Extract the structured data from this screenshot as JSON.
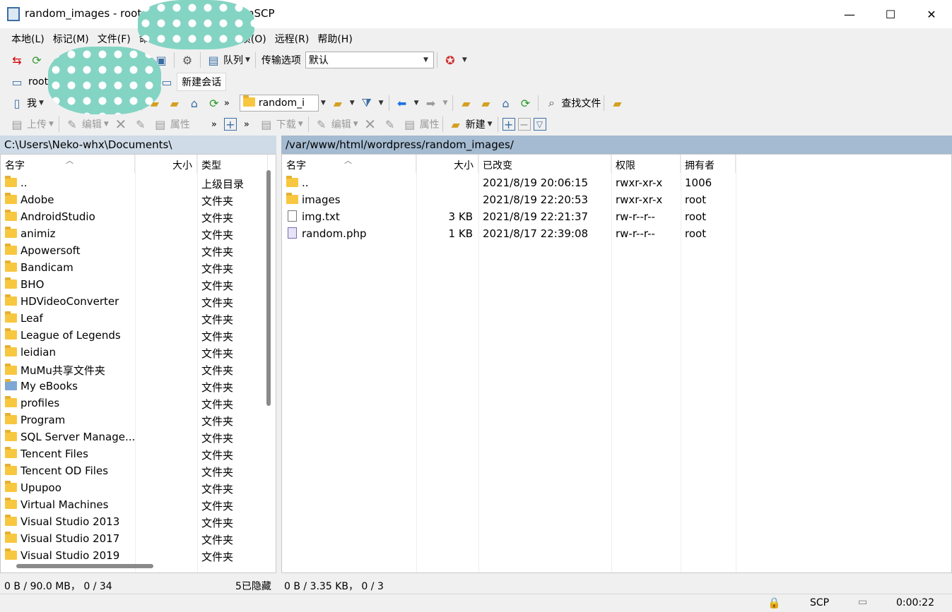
{
  "window": {
    "title": "random_images - root@",
    "title_tail": "nSCP",
    "minimize": "—",
    "maximize": "☐",
    "close": "✕"
  },
  "menu": [
    "本地(L)",
    "标记(M)",
    "文件(F)",
    "命",
    "",
    "",
    "项(O)",
    "远程(R)",
    "帮助(H)"
  ],
  "toolbar1": {
    "queue_label": "队列",
    "transfer_options_label": "传输选项",
    "transfer_options_value": "默认"
  },
  "session": {
    "tab_label": "root@",
    "new_session": "新建会话"
  },
  "local_nav": {
    "drive": "我"
  },
  "remote_nav": {
    "dir": "random_i",
    "find_files": "查找文件"
  },
  "local_actions": {
    "upload": "上传",
    "edit": "编辑",
    "properties": "属性"
  },
  "remote_actions": {
    "download": "下载",
    "edit": "编辑",
    "properties": "属性",
    "new": "新建"
  },
  "local_path": "C:\\Users\\Neko-whx\\Documents\\",
  "remote_path": "/var/www/html/wordpress/random_images/",
  "local_columns": {
    "name": "名字",
    "size": "大小",
    "type": "类型"
  },
  "remote_columns": {
    "name": "名字",
    "size": "大小",
    "modified": "已改变",
    "perms": "权限",
    "owner": "拥有者"
  },
  "local_files": [
    {
      "name": "..",
      "type": "上级目录",
      "icon": "parent"
    },
    {
      "name": "Adobe",
      "type": "文件夹",
      "icon": "folder"
    },
    {
      "name": "AndroidStudio",
      "type": "文件夹",
      "icon": "folder"
    },
    {
      "name": "animiz",
      "type": "文件夹",
      "icon": "folder"
    },
    {
      "name": "Apowersoft",
      "type": "文件夹",
      "icon": "folder"
    },
    {
      "name": "Bandicam",
      "type": "文件夹",
      "icon": "folder"
    },
    {
      "name": "BHO",
      "type": "文件夹",
      "icon": "folder"
    },
    {
      "name": "HDVideoConverter",
      "type": "文件夹",
      "icon": "folder"
    },
    {
      "name": "Leaf",
      "type": "文件夹",
      "icon": "folder"
    },
    {
      "name": "League of Legends",
      "type": "文件夹",
      "icon": "folder"
    },
    {
      "name": "leidian",
      "type": "文件夹",
      "icon": "folder"
    },
    {
      "name": "MuMu共享文件夹",
      "type": "文件夹",
      "icon": "folder"
    },
    {
      "name": "My eBooks",
      "type": "文件夹",
      "icon": "ebooks"
    },
    {
      "name": "profiles",
      "type": "文件夹",
      "icon": "folder"
    },
    {
      "name": "Program",
      "type": "文件夹",
      "icon": "folder"
    },
    {
      "name": "SQL Server Manage...",
      "type": "文件夹",
      "icon": "folder"
    },
    {
      "name": "Tencent Files",
      "type": "文件夹",
      "icon": "folder"
    },
    {
      "name": "Tencent OD Files",
      "type": "文件夹",
      "icon": "folder"
    },
    {
      "name": "Upupoo",
      "type": "文件夹",
      "icon": "folder"
    },
    {
      "name": "Virtual Machines",
      "type": "文件夹",
      "icon": "folder"
    },
    {
      "name": "Visual Studio 2013",
      "type": "文件夹",
      "icon": "folder"
    },
    {
      "name": "Visual Studio 2017",
      "type": "文件夹",
      "icon": "folder"
    },
    {
      "name": "Visual Studio 2019",
      "type": "文件夹",
      "icon": "folder"
    }
  ],
  "remote_files": [
    {
      "name": "..",
      "size": "",
      "modified": "2021/8/19 20:06:15",
      "perms": "rwxr-xr-x",
      "owner": "1006",
      "icon": "parent"
    },
    {
      "name": "images",
      "size": "",
      "modified": "2021/8/19 22:20:53",
      "perms": "rwxr-xr-x",
      "owner": "root",
      "icon": "folder"
    },
    {
      "name": "img.txt",
      "size": "3 KB",
      "modified": "2021/8/19 22:21:37",
      "perms": "rw-r--r--",
      "owner": "root",
      "icon": "text"
    },
    {
      "name": "random.php",
      "size": "1 KB",
      "modified": "2021/8/17 22:39:08",
      "perms": "rw-r--r--",
      "owner": "root",
      "icon": "php"
    }
  ],
  "local_status": {
    "summary": "0 B / 90.0 MB， 0 / 34",
    "hidden": "5已隐藏"
  },
  "remote_status": {
    "summary": "0 B / 3.35 KB， 0 / 3"
  },
  "bottom": {
    "protocol": "SCP",
    "elapsed": "0:00:22"
  }
}
